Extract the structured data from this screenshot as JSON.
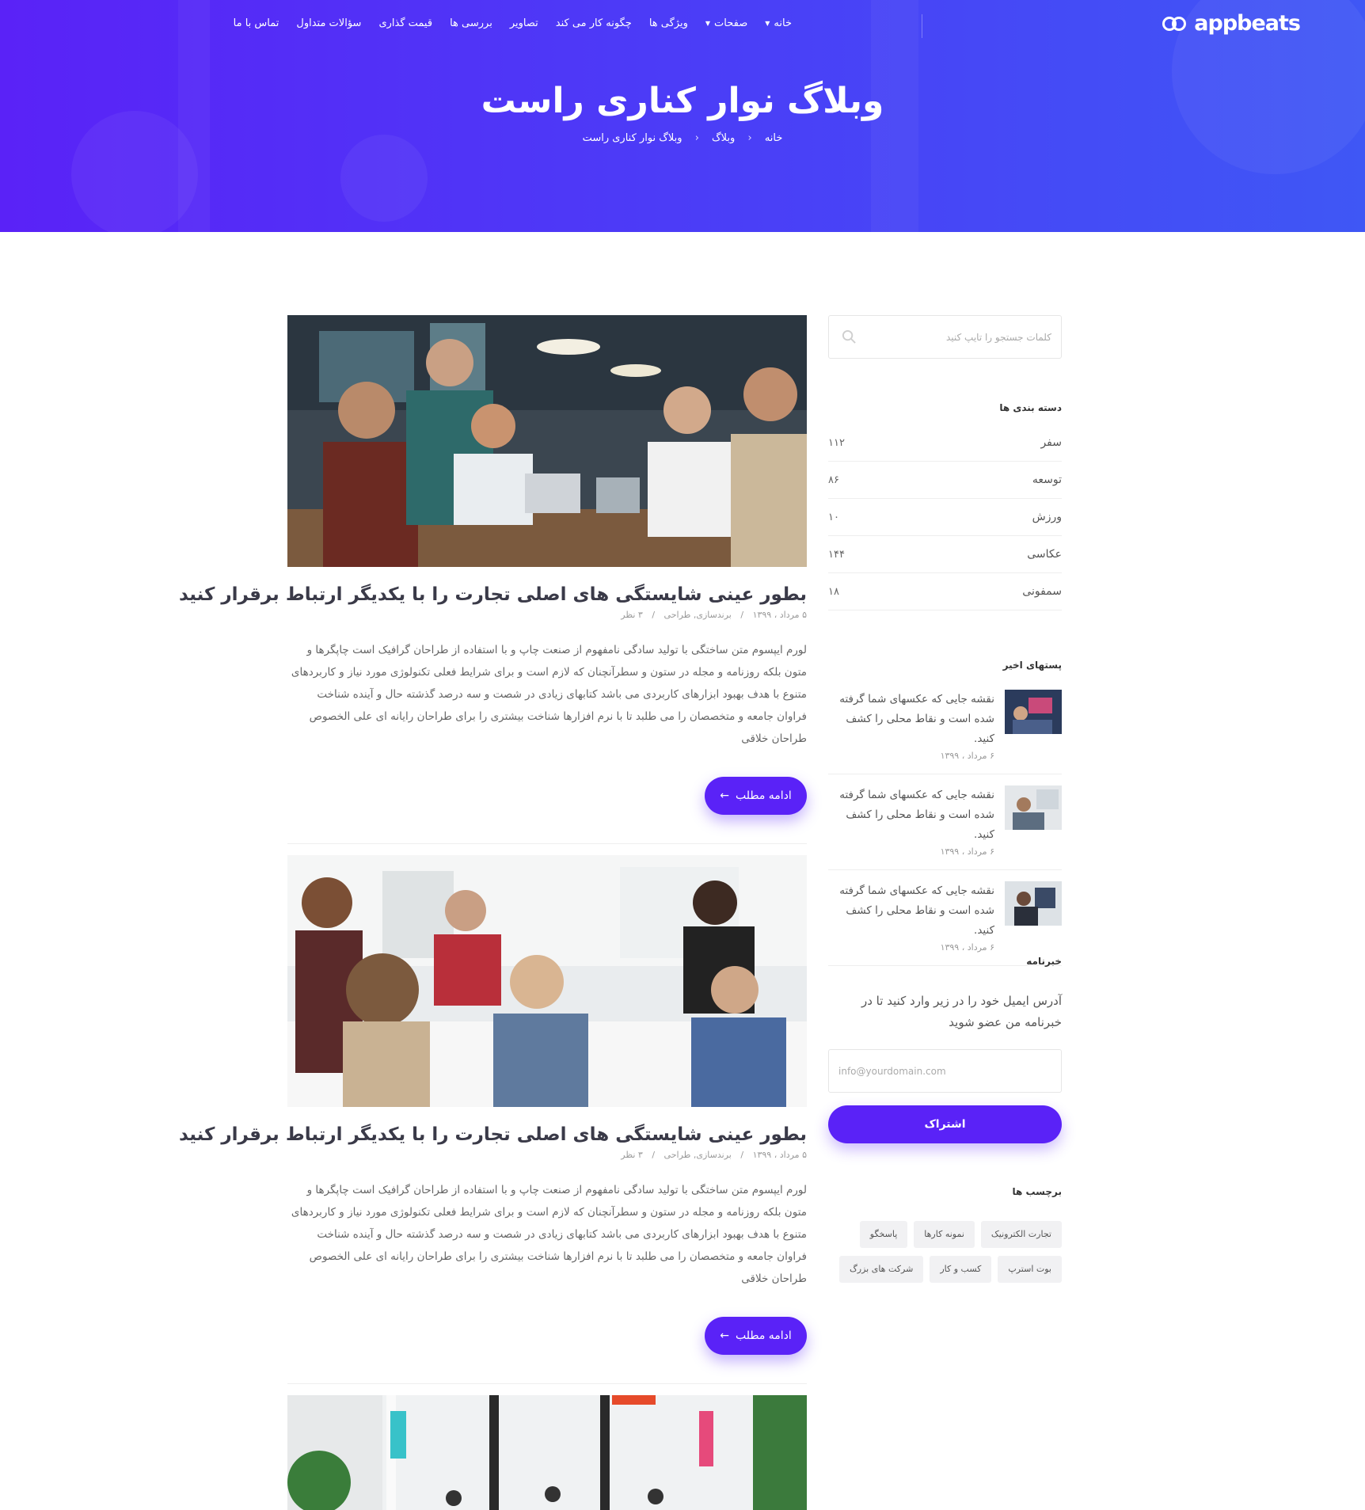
{
  "brand": {
    "name": "appbeats"
  },
  "nav": {
    "items": [
      {
        "label": "خانه",
        "has_dropdown": true
      },
      {
        "label": "صفحات",
        "has_dropdown": true
      },
      {
        "label": "ویژگی ها",
        "has_dropdown": false
      },
      {
        "label": "چگونه کار می کند",
        "has_dropdown": false
      },
      {
        "label": "تصاویر",
        "has_dropdown": false
      },
      {
        "label": "بررسی ها",
        "has_dropdown": false
      },
      {
        "label": "قیمت گذاری",
        "has_dropdown": false
      },
      {
        "label": "سؤالات متداول",
        "has_dropdown": false
      },
      {
        "label": "تماس با ما",
        "has_dropdown": false
      }
    ]
  },
  "hero": {
    "title": "وبلاگ نوار کناری راست",
    "breadcrumb": [
      "خانه",
      "وبلاگ",
      "وبلاگ نوار کناری راست"
    ]
  },
  "posts": [
    {
      "title": "بطور عینی شایستگی های اصلی تجارت را با یکدیگر ارتباط برقرار کنید",
      "date": "۵ مرداد ، ۱۳۹۹",
      "categories": "برندسازی, طراحی",
      "comments": "۳ نظر",
      "body": "لورم ایپسوم متن ساختگی با تولید سادگی نامفهوم از صنعت چاپ و با استفاده از طراحان گرافیک است چاپگرها و متون بلکه روزنامه و مجله در ستون و سطرآنچنان که لازم است و برای شرایط فعلی تکنولوژی مورد نیاز و کاربردهای متنوع با هدف بهبود ابزارهای کاربردی می باشد کتابهای زیادی در شصت و سه درصد گذشته حال و آینده شناخت فراوان جامعه و متخصصان را می طلبد تا با نرم افزارها شناخت بیشتری را برای طراحان رایانه ای علی الخصوص طراحان خلاقی",
      "button": "ادامه مطلب"
    },
    {
      "title": "بطور عینی شایستگی های اصلی تجارت را با یکدیگر ارتباط برقرار کنید",
      "date": "۵ مرداد ، ۱۳۹۹",
      "categories": "برندسازی, طراحی",
      "comments": "۳ نظر",
      "body": "لورم ایپسوم متن ساختگی با تولید سادگی نامفهوم از صنعت چاپ و با استفاده از طراحان گرافیک است چاپگرها و متون بلکه روزنامه و مجله در ستون و سطرآنچنان که لازم است و برای شرایط فعلی تکنولوژی مورد نیاز و کاربردهای متنوع با هدف بهبود ابزارهای کاربردی می باشد کتابهای زیادی در شصت و سه درصد گذشته حال و آینده شناخت فراوان جامعه و متخصصان را می طلبد تا با نرم افزارها شناخت بیشتری را برای طراحان رایانه ای علی الخصوص طراحان خلاقی",
      "button": "ادامه مطلب"
    }
  ],
  "sidebar": {
    "search_placeholder": "کلمات جستجو را تایپ کنید",
    "categories_title": "دسته بندی ها",
    "categories": [
      {
        "name": "سفر",
        "count": "۱۱۲"
      },
      {
        "name": "توسعه",
        "count": "۸۶"
      },
      {
        "name": "ورزش",
        "count": "۱۰"
      },
      {
        "name": "عکاسی",
        "count": "۱۴۴"
      },
      {
        "name": "سمفونی",
        "count": "۱۸"
      }
    ],
    "recent_title": "پستهای اخیر",
    "recent": [
      {
        "text": "نقشه جایی که عکسهای شما گرفته شده است و نقاط محلی را کشف کنید.",
        "date": "۶ مرداد ، ۱۳۹۹"
      },
      {
        "text": "نقشه جایی که عکسهای شما گرفته شده است و نقاط محلی را کشف کنید.",
        "date": "۶ مرداد ، ۱۳۹۹"
      },
      {
        "text": "نقشه جایی که عکسهای شما گرفته شده است و نقاط محلی را کشف کنید.",
        "date": "۶ مرداد ، ۱۳۹۹"
      }
    ],
    "newsletter_title": "خبرنامه",
    "newsletter_text": "آدرس ایمیل خود را در زیر وارد کنید تا در خبرنامه من عضو شوید",
    "newsletter_placeholder": "info@yourdomain.com",
    "newsletter_button": "اشتراک",
    "tags_title": "برچسب ها",
    "tags": [
      "تجارت الکترونیک",
      "نمونه کارها",
      "پاسخگو",
      "بوت استرپ",
      "کسب و کار",
      "شرکت های بزرگ"
    ]
  },
  "colors": {
    "accent": "#5a22f7",
    "hero_start": "#5a22f7",
    "hero_end": "#3f57f5"
  }
}
